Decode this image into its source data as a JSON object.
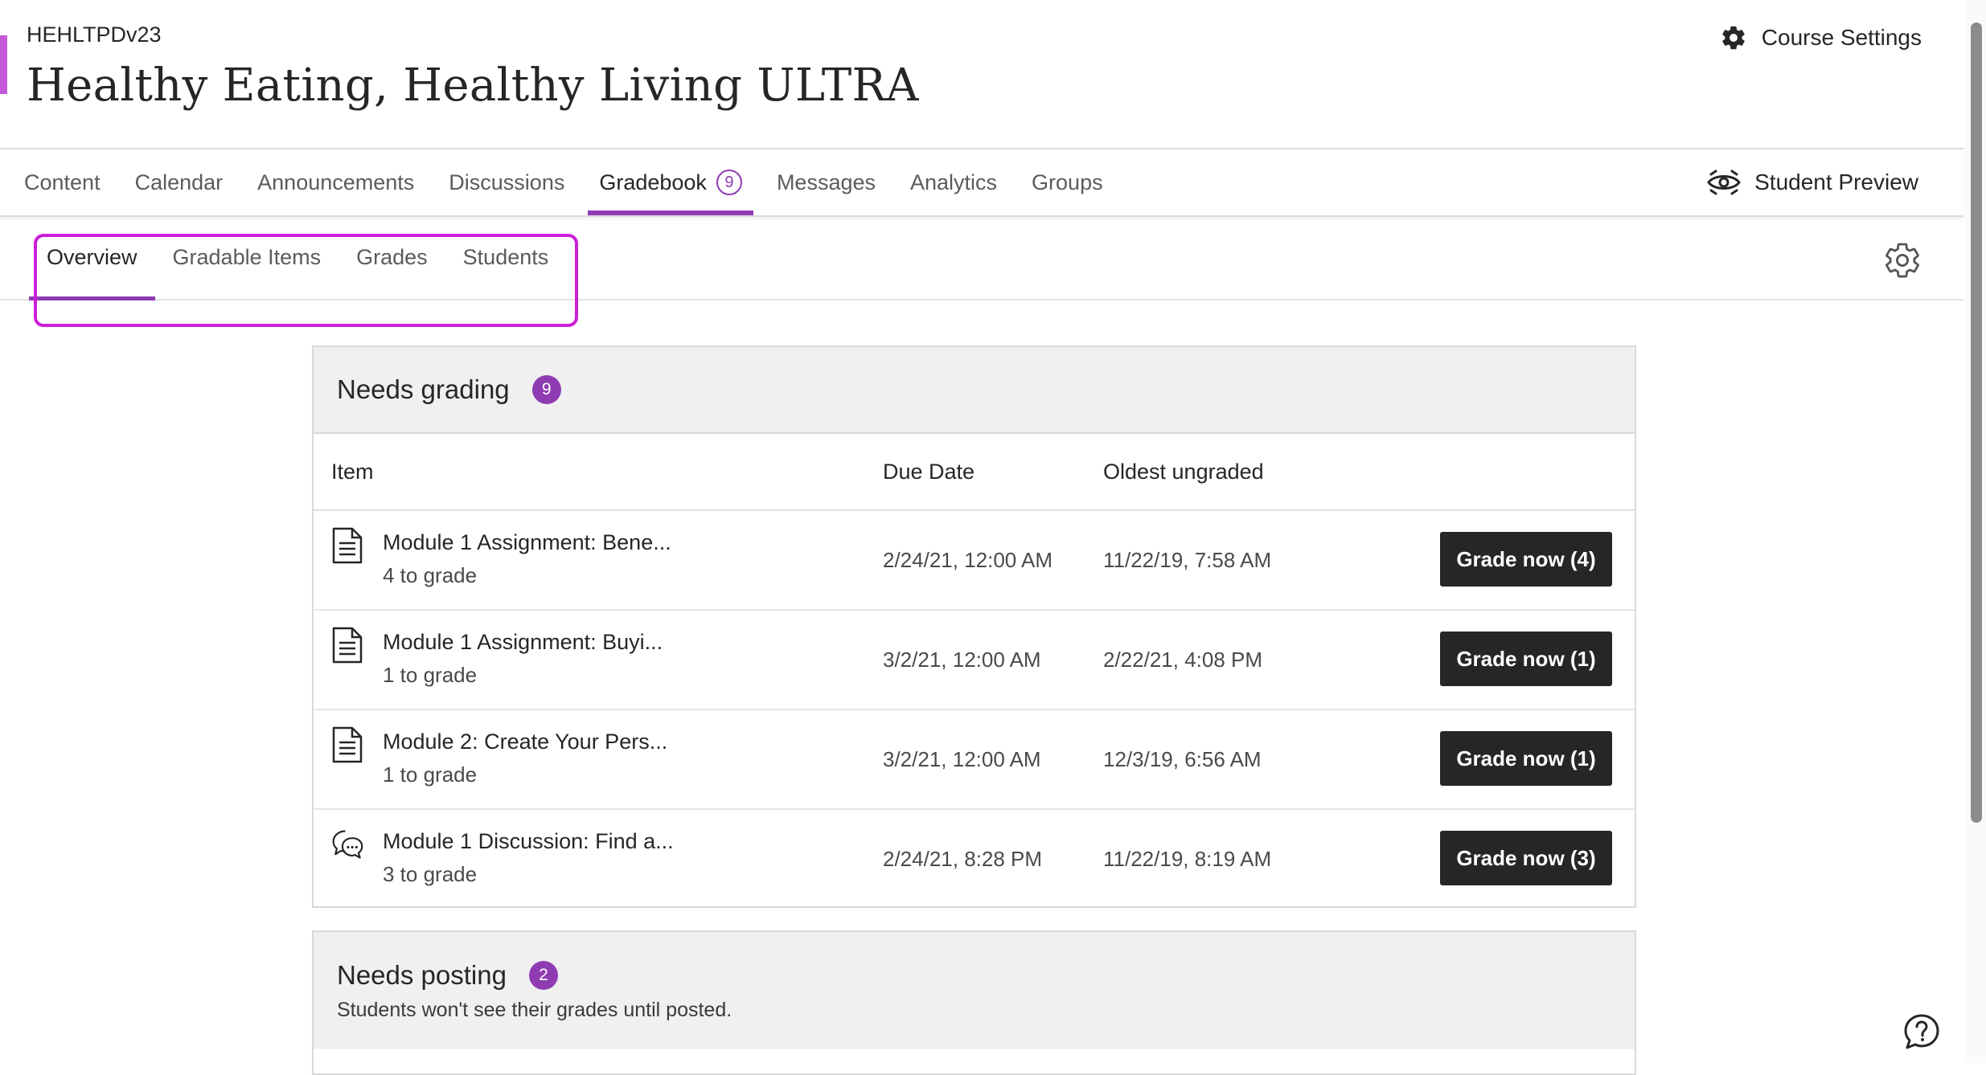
{
  "course": {
    "code": "HEHLTPDv23",
    "title": "Healthy Eating, Healthy Living ULTRA",
    "settings_label": "Course Settings",
    "accent_color": "#c359d6"
  },
  "nav": {
    "tabs": [
      {
        "label": "Content"
      },
      {
        "label": "Calendar"
      },
      {
        "label": "Announcements"
      },
      {
        "label": "Discussions"
      },
      {
        "label": "Gradebook",
        "badge": "9",
        "active": true
      },
      {
        "label": "Messages"
      },
      {
        "label": "Analytics"
      },
      {
        "label": "Groups"
      }
    ],
    "student_preview": "Student Preview"
  },
  "subnav": {
    "tabs": [
      {
        "label": "Overview",
        "active": true
      },
      {
        "label": "Gradable Items"
      },
      {
        "label": "Grades"
      },
      {
        "label": "Students"
      }
    ]
  },
  "needs_grading": {
    "title": "Needs grading",
    "count": "9",
    "columns": {
      "item": "Item",
      "due": "Due Date",
      "oldest": "Oldest ungraded"
    },
    "rows": [
      {
        "icon": "document-icon",
        "name": "Module 1 Assignment: Bene...",
        "sub": "4 to grade",
        "due": "2/24/21, 12:00 AM",
        "oldest": "11/22/19, 7:58 AM",
        "button": "Grade now (4)"
      },
      {
        "icon": "document-icon",
        "name": "Module 1 Assignment: Buyi...",
        "sub": "1 to grade",
        "due": "3/2/21, 12:00 AM",
        "oldest": "2/22/21, 4:08 PM",
        "button": "Grade now (1)"
      },
      {
        "icon": "document-icon",
        "name": "Module 2: Create Your Pers...",
        "sub": "1 to grade",
        "due": "3/2/21, 12:00 AM",
        "oldest": "12/3/19, 6:56 AM",
        "button": "Grade now (1)"
      },
      {
        "icon": "discussion-icon",
        "name": "Module 1 Discussion: Find a...",
        "sub": "3 to grade",
        "due": "2/24/21, 8:28 PM",
        "oldest": "11/22/19, 8:19 AM",
        "button": "Grade now (3)"
      }
    ]
  },
  "needs_posting": {
    "title": "Needs posting",
    "count": "2",
    "description": "Students won't see their grades until posted."
  },
  "colors": {
    "brand_purple": "#8f3cb3",
    "highlight_magenta": "#cc1fd6",
    "button_dark": "#262626"
  }
}
